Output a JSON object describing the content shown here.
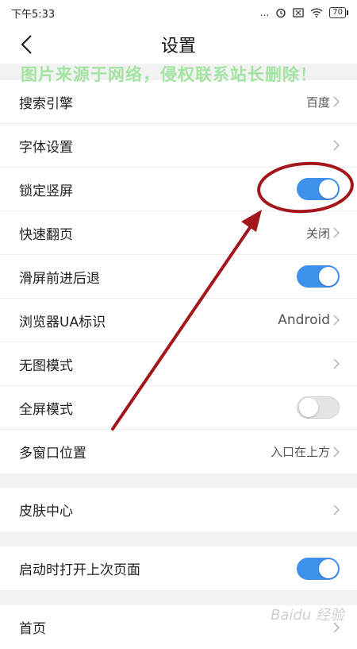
{
  "status_bar": {
    "time": "下午5:33",
    "signal": "...",
    "battery": "70"
  },
  "header": {
    "title": "设置"
  },
  "watermark": "图片来源于网络，侵权联系站长删除！",
  "settings": [
    {
      "label": "搜索引擎",
      "value": "百度"
    },
    {
      "label": "字体设置",
      "value": ""
    },
    {
      "label": "锁定竖屏",
      "toggle": true
    },
    {
      "label": "快速翻页",
      "value": "关闭"
    },
    {
      "label": "滑屏前进后退",
      "toggle": true
    },
    {
      "label": "浏览器UA标识",
      "value": "Android"
    },
    {
      "label": "无图模式",
      "value": ""
    },
    {
      "label": "全屏模式",
      "toggle": false
    },
    {
      "label": "多窗口位置",
      "value": "入口在上方"
    }
  ],
  "skin": {
    "label": "皮肤中心"
  },
  "startup": {
    "label": "启动时打开上次页面",
    "toggle": true
  },
  "home": {
    "label": "首页"
  },
  "colors": {
    "accent": "#3f92ec",
    "annotation": "#a3171c",
    "watermark": "#9be39a"
  },
  "brand_watermark": "Baidu 经验"
}
